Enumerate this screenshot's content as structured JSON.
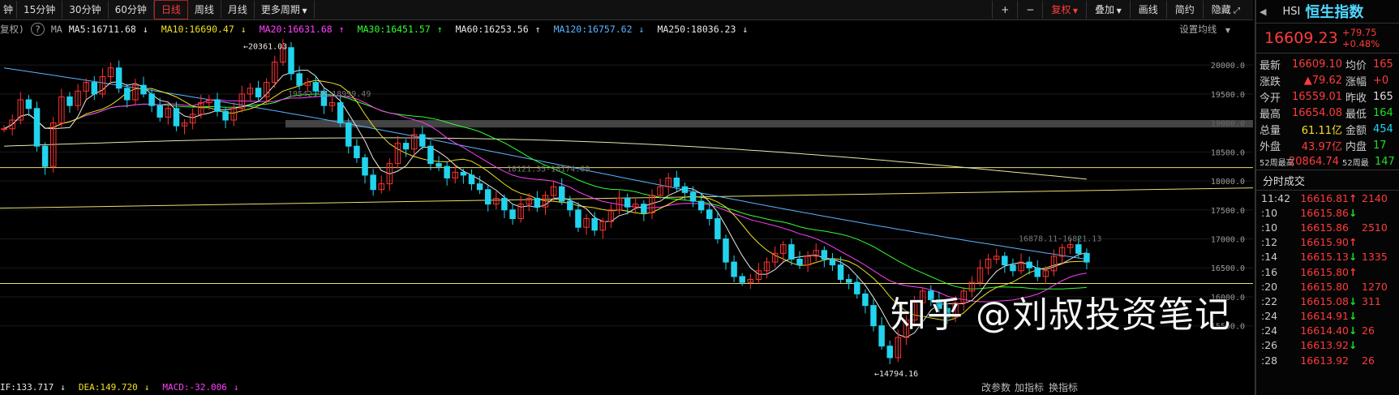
{
  "toolbar": {
    "left_cut": "钟",
    "tabs": [
      "15分钟",
      "30分钟",
      "60分钟",
      "日线",
      "周线",
      "月线",
      "更多周期"
    ],
    "active_tab": "日线",
    "zoom_in": "+",
    "zoom_out": "−",
    "buttons": [
      "复权",
      "叠加",
      "画线",
      "简约",
      "隐藏"
    ]
  },
  "ma_bar": {
    "prefix": "复权)",
    "help": "?",
    "ma_label": "MA",
    "items": [
      {
        "text": "MA5:16711.68",
        "arrow": "↓",
        "color": "#e8e8e8"
      },
      {
        "text": "MA10:16690.47",
        "arrow": "↓",
        "color": "#f0e020"
      },
      {
        "text": "MA20:16631.68",
        "arrow": "↑",
        "color": "#ff40ff"
      },
      {
        "text": "MA30:16451.57",
        "arrow": "↑",
        "color": "#30ff30"
      },
      {
        "text": "MA60:16253.56",
        "arrow": "↑",
        "color": "#e8e8e8"
      },
      {
        "text": "MA120:16757.62",
        "arrow": "↓",
        "color": "#5ab4ff"
      },
      {
        "text": "MA250:18036.23",
        "arrow": "↓",
        "color": "#e8e8e8"
      }
    ],
    "settings": "设置均线"
  },
  "chart_data": {
    "type": "candlestick",
    "y_ticks": [
      "20000.0",
      "19500.0",
      "19000.0",
      "18500.0",
      "18000.0",
      "17500.0",
      "17000.0",
      "16500.0",
      "16000.0",
      "15500.0"
    ],
    "ylim": [
      14600,
      20450
    ],
    "annotations": {
      "high": "20361.03",
      "low": "14794.16",
      "line1": "19542.92-18999.49",
      "line2": "18121.35-18174.69",
      "line3": "16878.11-16821.13"
    },
    "candles": [
      18900,
      19050,
      19400,
      19250,
      18600,
      18250,
      19000,
      19450,
      19300,
      19550,
      19700,
      19500,
      19800,
      19950,
      19600,
      19400,
      19650,
      19500,
      19300,
      19100,
      19250,
      18950,
      19000,
      19150,
      19350,
      19400,
      19200,
      19050,
      19250,
      19500,
      19600,
      19450,
      19700,
      20050,
      20300,
      19850,
      19650,
      19700,
      19550,
      19300,
      19350,
      19000,
      18600,
      18400,
      18100,
      17850,
      17950,
      18300,
      18650,
      18550,
      18800,
      18600,
      18300,
      18250,
      18050,
      18150,
      18100,
      17950,
      17850,
      17600,
      17700,
      17500,
      17350,
      17600,
      17700,
      17550,
      17750,
      17900,
      17650,
      17500,
      17200,
      17350,
      17150,
      17300,
      17500,
      17700,
      17550,
      17600,
      17450,
      17750,
      17900,
      18050,
      17900,
      17800,
      17650,
      17500,
      17350,
      17000,
      16600,
      16350,
      16250,
      16300,
      16450,
      16600,
      16750,
      16900,
      16650,
      16550,
      16700,
      16800,
      16650,
      16550,
      16300,
      16250,
      16050,
      15850,
      15500,
      15150,
      14950,
      15300,
      15600,
      15900,
      16100,
      15950,
      15800,
      15650,
      15900,
      16100,
      16250,
      16500,
      16650,
      16700,
      16550,
      16450,
      16600,
      16500,
      16350,
      16450,
      16700,
      16850,
      16900,
      16750,
      16600
    ]
  },
  "bottom": {
    "items": [
      {
        "text": "IF:133.717",
        "arrow": "↓",
        "color": "#e8e8e8"
      },
      {
        "text": "DEA:149.720",
        "arrow": "↓",
        "color": "#f0e020"
      },
      {
        "text": "MACD:-32.006",
        "arrow": "↓",
        "color": "#ff40ff"
      }
    ],
    "btn1": "改参数",
    "btn2": "加指标",
    "btn3": "换指标"
  },
  "side": {
    "code": "HSI",
    "name": "恒生指数",
    "price": "16609.23",
    "change": "+79.75",
    "pct": "+0.48%",
    "stats": [
      {
        "l1": "最新",
        "v1": "16609.10",
        "c1": "red",
        "l2": "均价",
        "v2": "165",
        "c2": "red"
      },
      {
        "l1": "涨跌",
        "v1": "▲79.62",
        "c1": "red",
        "l2": "涨幅",
        "v2": "+0",
        "c2": "red"
      },
      {
        "l1": "今开",
        "v1": "16559.01",
        "c1": "red",
        "l2": "昨收",
        "v2": "165",
        "c2": "wht"
      },
      {
        "l1": "最高",
        "v1": "16654.08",
        "c1": "red",
        "l2": "最低",
        "v2": "164",
        "c2": "grn"
      },
      {
        "l1": "总量",
        "v1": "61.11亿",
        "c1": "yel",
        "l2": "金额",
        "v2": "454",
        "c2": "cyan"
      },
      {
        "l1": "外盘",
        "v1": "43.97亿",
        "c1": "red",
        "l2": "内盘",
        "v2": "17",
        "c2": "grn"
      },
      {
        "l1": "52周最高",
        "v1": "20864.74",
        "c1": "red",
        "l2": "52周最",
        "v2": "147",
        "c2": "grn"
      }
    ],
    "ticks_title": "分时成交",
    "ticks": [
      {
        "t": "11:42",
        "p": "16616.81",
        "a": "↑",
        "ac": "red",
        "v": "2140"
      },
      {
        "t": ":10",
        "p": "16615.86",
        "a": "↓",
        "ac": "grn",
        "v": ""
      },
      {
        "t": ":10",
        "p": "16615.86",
        "a": "",
        "ac": "red",
        "v": "2510"
      },
      {
        "t": ":12",
        "p": "16615.90",
        "a": "↑",
        "ac": "red",
        "v": ""
      },
      {
        "t": ":14",
        "p": "16615.13",
        "a": "↓",
        "ac": "grn",
        "v": "1335"
      },
      {
        "t": ":16",
        "p": "16615.80",
        "a": "↑",
        "ac": "red",
        "v": ""
      },
      {
        "t": ":20",
        "p": "16615.80",
        "a": "",
        "ac": "red",
        "v": "1270"
      },
      {
        "t": ":22",
        "p": "16615.08",
        "a": "↓",
        "ac": "grn",
        "v": "311"
      },
      {
        "t": ":24",
        "p": "16614.91",
        "a": "↓",
        "ac": "grn",
        "v": ""
      },
      {
        "t": ":24",
        "p": "16614.40",
        "a": "↓",
        "ac": "grn",
        "v": "26"
      },
      {
        "t": ":26",
        "p": "16613.92",
        "a": "↓",
        "ac": "grn",
        "v": ""
      },
      {
        "t": ":28",
        "p": "16613.92",
        "a": "",
        "ac": "red",
        "v": "26"
      }
    ]
  },
  "watermark": "知乎 @刘叔投资笔记"
}
